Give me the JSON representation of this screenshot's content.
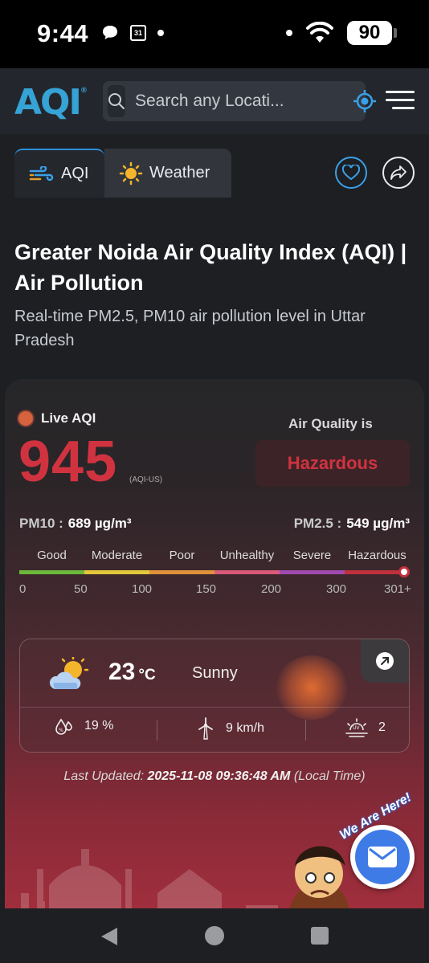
{
  "status_bar": {
    "time": "9:44",
    "battery": "90",
    "icons": [
      "chat-bubble-icon",
      "calendar-icon",
      "dot-icon",
      "dot-icon",
      "wifi-icon",
      "battery-icon"
    ],
    "calendar_day": "31"
  },
  "header": {
    "logo_text": "AQI",
    "logo_mark": "®",
    "search_placeholder": "Search any Locati...",
    "colors": {
      "brand": "#36a3d6",
      "header_bg": "#23272d"
    }
  },
  "tabs": [
    {
      "label": "AQI",
      "active": true,
      "icon": "wind-icon"
    },
    {
      "label": "Weather",
      "active": false,
      "icon": "sun-icon"
    }
  ],
  "actions": {
    "favorite_icon": "heart-icon",
    "share_icon": "share-icon"
  },
  "page": {
    "title": "Greater Noida Air Quality Index (AQI) | Air Pollution",
    "subtitle": "Real-time PM2.5, PM10 air pollution level in Uttar Pradesh"
  },
  "aqi": {
    "live_label": "Live AQI",
    "value": "945",
    "unit": "(AQI-US)",
    "air_quality_label": "Air Quality is",
    "status": "Hazardous",
    "pm10_label": "PM10 :",
    "pm10_value": "689 µg/m³",
    "pm25_label": "PM2.5 :",
    "pm25_value": "549 µg/m³",
    "scale_labels": [
      "Good",
      "Moderate",
      "Poor",
      "Unhealthy",
      "Severe",
      "Hazardous"
    ],
    "scale_colors": [
      "#6bb83a",
      "#e4c63a",
      "#e0913a",
      "#d95a78",
      "#a04ab0",
      "#c0303c"
    ],
    "scale_numbers": [
      "0",
      "50",
      "100",
      "150",
      "200",
      "300",
      "301+"
    ],
    "colors": {
      "aqi_value": "#d0333f"
    }
  },
  "weather": {
    "temperature": "23",
    "temp_unit": "°C",
    "condition": "Sunny",
    "humidity": "19 %",
    "wind": "9 km/h",
    "uv": "2",
    "icons": [
      "partly-sunny-icon",
      "humidity-icon",
      "wind-turbine-icon",
      "uv-index-icon",
      "expand-arrow-icon"
    ]
  },
  "updated": {
    "label": "Last Updated:",
    "datetime": "2025-11-08 09:36:48 AM",
    "suffix": "(Local Time)"
  },
  "mascot": {
    "callout": "We Are Here!"
  },
  "nav": {
    "icons": [
      "back-icon",
      "home-icon",
      "recents-icon"
    ]
  }
}
